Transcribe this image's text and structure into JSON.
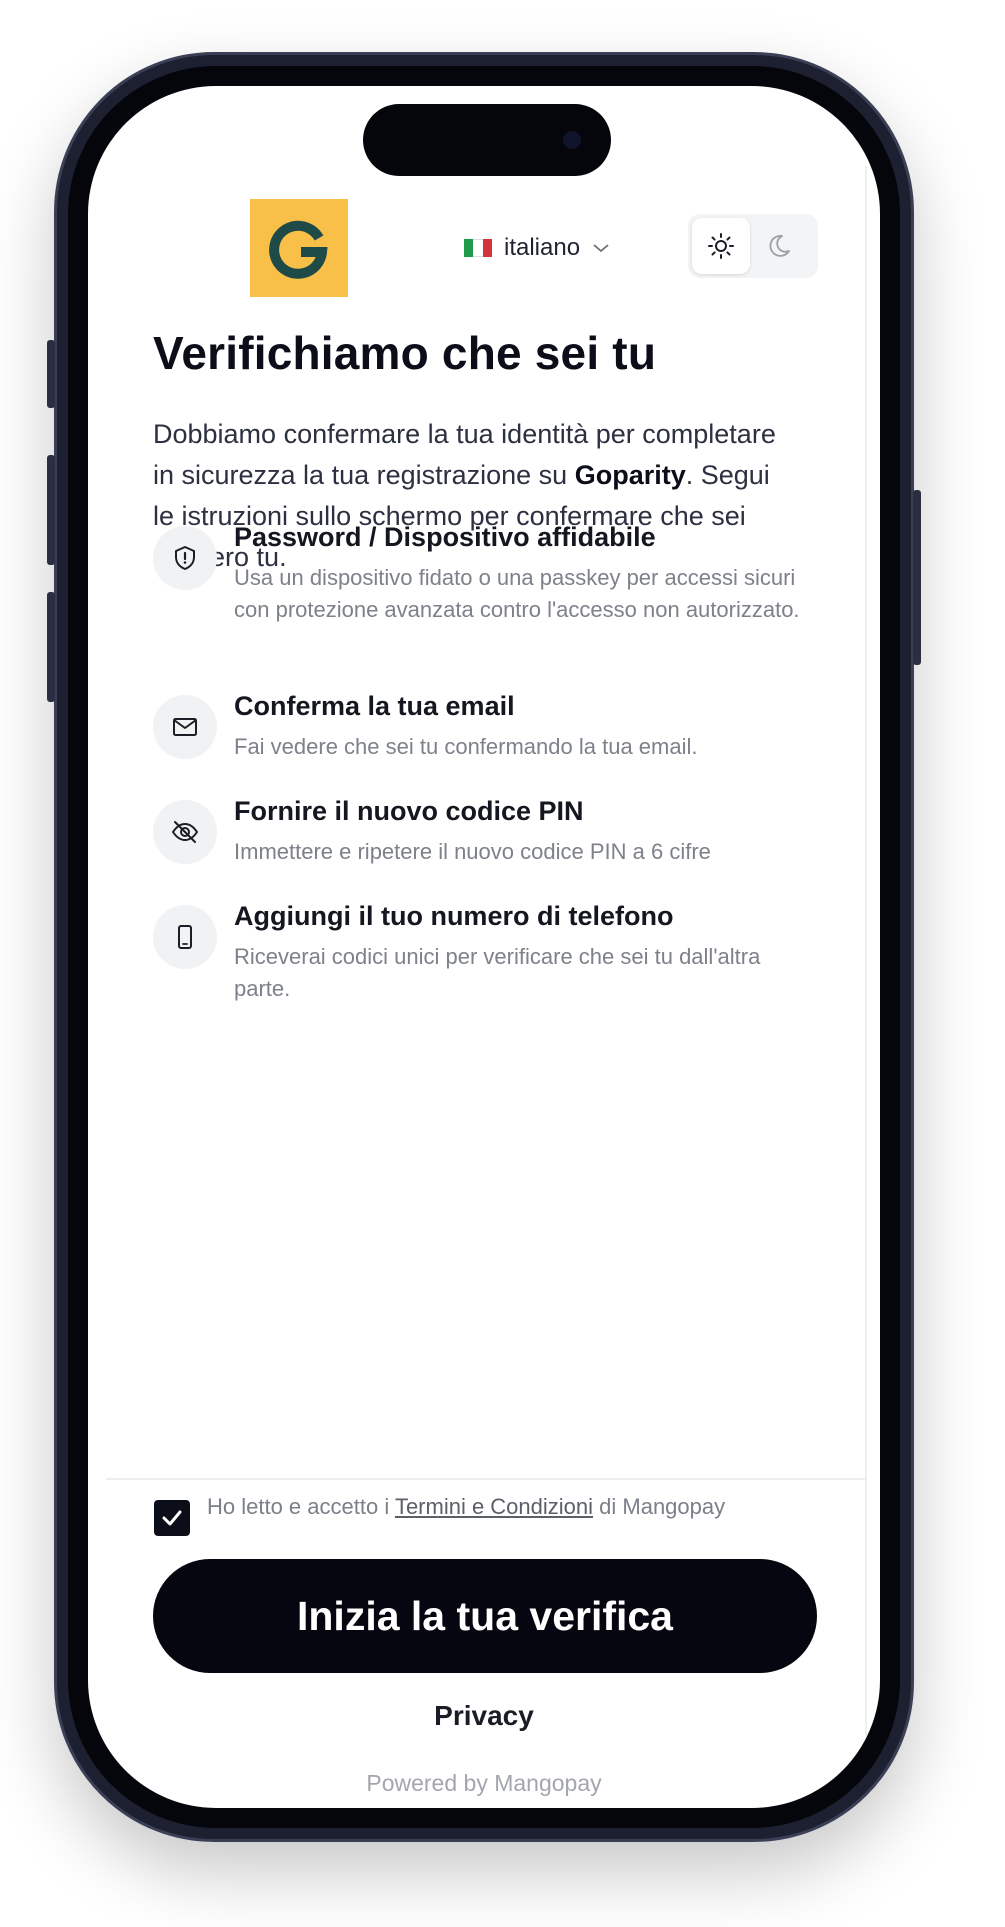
{
  "header": {
    "logo_letter": "G",
    "language": {
      "label": "italiano",
      "flag": "italy-flag"
    },
    "theme": {
      "options": [
        "light",
        "dark"
      ],
      "selected": "light"
    }
  },
  "main": {
    "title": "Verifichiamo che sei tu",
    "intro": {
      "before": "Dobbiamo confermare la tua identità per completare in sicurezza la tua registrazione su ",
      "brand": "Goparity",
      "after": ". Segui le istruzioni sullo schermo per confermare che sei davvero tu."
    },
    "steps": [
      {
        "icon": "shield-icon",
        "title": "Password / Dispositivo affidabile",
        "description": "Usa un dispositivo fidato o una passkey per accessi sicuri con protezione avanzata contro l'accesso non autorizzato."
      },
      {
        "icon": "mail-icon",
        "title": "Conferma la tua email",
        "description": "Fai vedere che sei tu confermando la tua email."
      },
      {
        "icon": "eye-off-icon",
        "title": "Fornire il nuovo codice PIN",
        "description": "Immettere e ripetere il nuovo codice PIN a 6 cifre"
      },
      {
        "icon": "phone-icon",
        "title": "Aggiungi il tuo numero di telefono",
        "description": "Riceverai codici unici per verificare che sei tu dall'altra parte."
      }
    ]
  },
  "footer": {
    "terms": {
      "checked": true,
      "before": "Ho letto e accetto i ",
      "link": "Termini e Condizioni",
      "after": " di Mangopay"
    },
    "cta_label": "Inizia la tua verifica",
    "privacy_label": "Privacy",
    "powered_by": "Powered by Mangopay"
  },
  "colors": {
    "logo_bg": "#f8bf49",
    "logo_fg": "#1e4a47",
    "cta_bg": "#05060f",
    "text_primary": "#0b0d18",
    "text_muted": "#7d8189"
  }
}
